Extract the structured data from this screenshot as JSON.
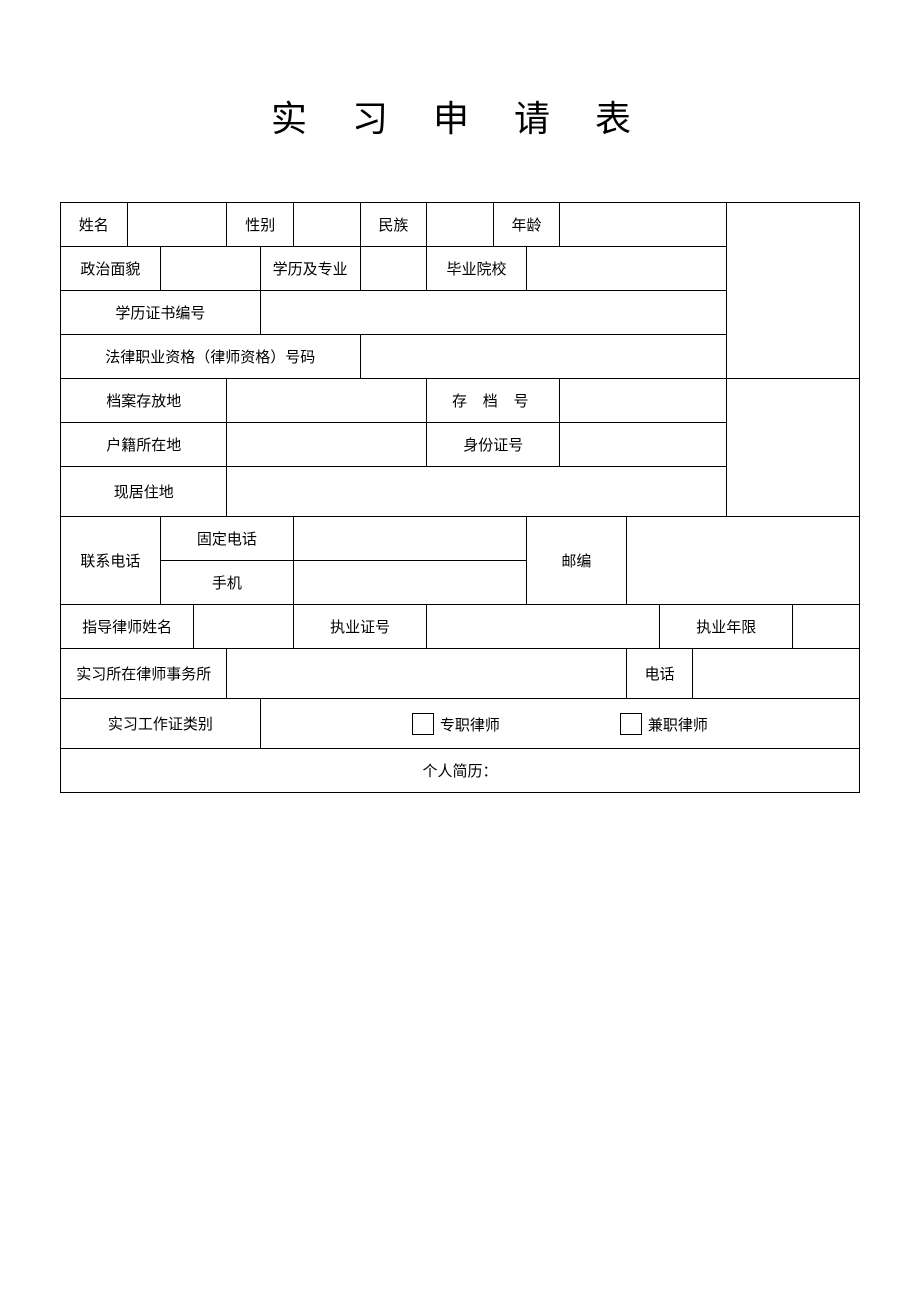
{
  "title": "实 习 申 请 表",
  "labels": {
    "name": "姓名",
    "gender": "性别",
    "ethnicity": "民族",
    "age": "年龄",
    "political": "政治面貌",
    "education": "学历及专业",
    "school": "毕业院校",
    "diploma_no": "学历证书编号",
    "legal_qual_no": "法律职业资格（律师资格）号码",
    "archive_loc": "档案存放地",
    "archive_no": "存 档 号",
    "hukou_loc": "户籍所在地",
    "id_no": "身份证号",
    "residence": "现居住地",
    "contact": "联系电话",
    "landline": "固定电话",
    "mobile": "手机",
    "postcode": "邮编",
    "mentor_name": "指导律师姓名",
    "license_no": "执业证号",
    "practice_years": "执业年限",
    "firm": "实习所在律师事务所",
    "phone": "电话",
    "cert_type": "实习工作证类别",
    "fulltime": "专职律师",
    "parttime": "兼职律师",
    "resume": "个人简历："
  },
  "values": {
    "name": "",
    "gender": "",
    "ethnicity": "",
    "age": "",
    "political": "",
    "education": "",
    "school": "",
    "diploma_no": "",
    "legal_qual_no": "",
    "archive_loc": "",
    "archive_no": "",
    "hukou_loc": "",
    "id_no": "",
    "residence": "",
    "landline": "",
    "mobile": "",
    "postcode": "",
    "mentor_name": "",
    "license_no": "",
    "practice_years": "",
    "firm": "",
    "firm_phone": "",
    "resume_text": ""
  },
  "checks": {
    "fulltime": false,
    "parttime": false
  },
  "photo_label": ""
}
